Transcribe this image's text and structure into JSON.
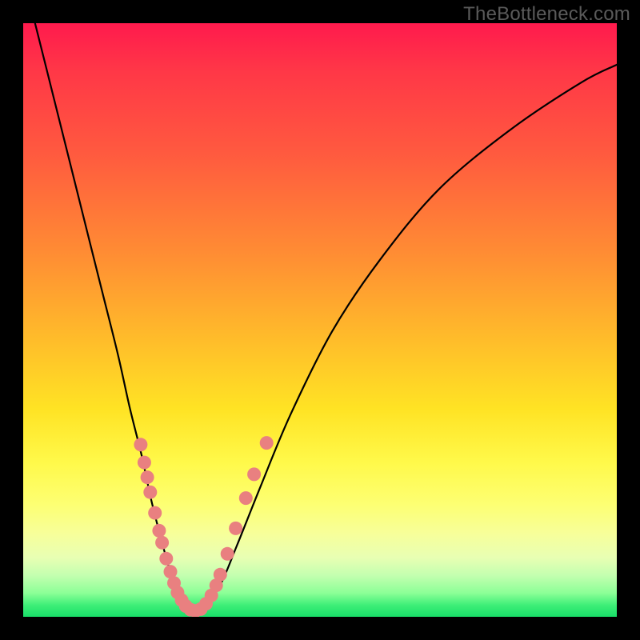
{
  "watermark": "TheBottleneck.com",
  "chart_data": {
    "type": "line",
    "title": "",
    "xlabel": "",
    "ylabel": "",
    "xlim": [
      0,
      100
    ],
    "ylim": [
      0,
      100
    ],
    "series": [
      {
        "name": "bottleneck-curve",
        "x": [
          2,
          5,
          8,
          11,
          13.5,
          16,
          18,
          20,
          21.5,
          23,
          24.5,
          26,
          27.5,
          30,
          33,
          36,
          40,
          45,
          52,
          60,
          70,
          82,
          94,
          100
        ],
        "y": [
          100,
          88,
          76,
          64,
          54,
          44,
          35,
          27,
          20,
          14,
          8.5,
          4,
          1.5,
          1.5,
          5,
          12,
          22,
          34,
          48,
          60,
          72,
          82,
          90,
          93
        ]
      }
    ],
    "scatter_points": {
      "name": "highlighted-points",
      "points": [
        {
          "x": 19.8,
          "y": 29
        },
        {
          "x": 20.4,
          "y": 26
        },
        {
          "x": 20.9,
          "y": 23.5
        },
        {
          "x": 21.4,
          "y": 21
        },
        {
          "x": 22.2,
          "y": 17.5
        },
        {
          "x": 22.9,
          "y": 14.5
        },
        {
          "x": 23.4,
          "y": 12.5
        },
        {
          "x": 24.1,
          "y": 9.8
        },
        {
          "x": 24.8,
          "y": 7.6
        },
        {
          "x": 25.4,
          "y": 5.7
        },
        {
          "x": 26.0,
          "y": 4.1
        },
        {
          "x": 26.7,
          "y": 2.8
        },
        {
          "x": 27.4,
          "y": 1.8
        },
        {
          "x": 28.2,
          "y": 1.2
        },
        {
          "x": 29.0,
          "y": 1.0
        },
        {
          "x": 29.9,
          "y": 1.3
        },
        {
          "x": 30.8,
          "y": 2.2
        },
        {
          "x": 31.7,
          "y": 3.6
        },
        {
          "x": 32.5,
          "y": 5.3
        },
        {
          "x": 33.2,
          "y": 7.1
        },
        {
          "x": 34.4,
          "y": 10.6
        },
        {
          "x": 35.8,
          "y": 14.9
        },
        {
          "x": 37.5,
          "y": 20.0
        },
        {
          "x": 38.9,
          "y": 24.0
        },
        {
          "x": 41.0,
          "y": 29.3
        }
      ]
    },
    "gradient_stops": [
      {
        "pos": 0.0,
        "color": "#ff1a4d"
      },
      {
        "pos": 0.38,
        "color": "#ff8a34"
      },
      {
        "pos": 0.74,
        "color": "#fff94a"
      },
      {
        "pos": 1.0,
        "color": "#18de68"
      }
    ]
  }
}
